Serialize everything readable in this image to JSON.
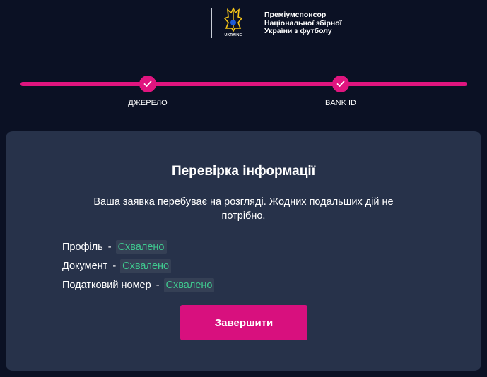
{
  "header": {
    "crest_label": "UKRAINE",
    "sponsor_text": "Преміумспонсор Національної збірної України з футболу"
  },
  "stepper": {
    "steps": [
      {
        "label": "ДЖЕРЕЛО",
        "status": "completed"
      },
      {
        "label": "BANK ID",
        "status": "completed"
      }
    ]
  },
  "card": {
    "title": "Перевірка інформації",
    "message": "Ваша заявка перебуває на розгляді. Жодних подальших дій не потрібно.",
    "statuses": [
      {
        "label": "Профіль",
        "separator": "-",
        "value": "Схвалено"
      },
      {
        "label": "Документ",
        "separator": "-",
        "value": "Схвалено"
      },
      {
        "label": "Податковий номер",
        "separator": "-",
        "value": "Схвалено"
      }
    ],
    "finish_button": "Завершити"
  },
  "colors": {
    "background": "#0b1124",
    "card": "#27324a",
    "accent": "#e0157f",
    "status_ok": "#3fc98f"
  }
}
